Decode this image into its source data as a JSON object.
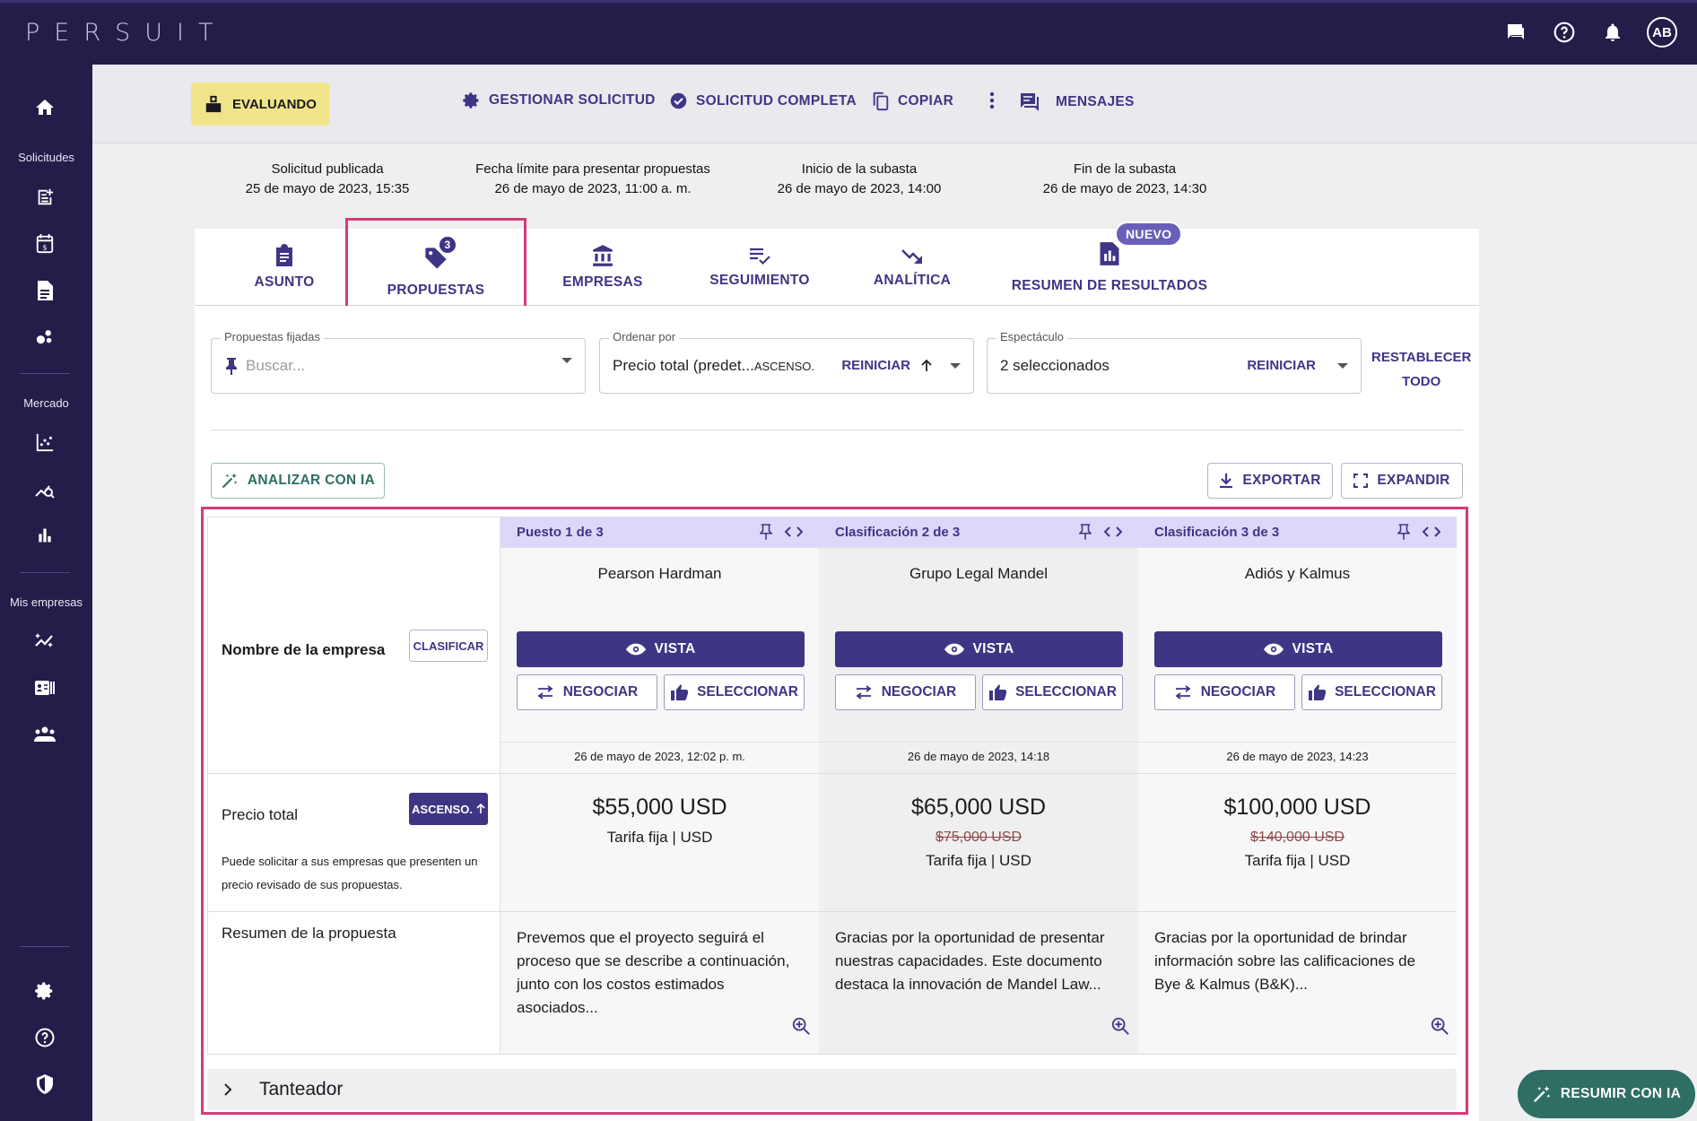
{
  "app": {
    "logo": "PERSUIT",
    "avatar_initials": "AB"
  },
  "sidebar": {
    "section_solicitudes": "Solicitudes",
    "section_mercado": "Mercado",
    "section_empresas": "Mis empresas"
  },
  "actionbar": {
    "status": "EVALUANDO",
    "manage": "GESTIONAR SOLICITUD",
    "complete": "SOLICITUD COMPLETA",
    "copy": "COPIAR",
    "messages": "MENSAJES"
  },
  "dates": [
    {
      "label": "Solicitud publicada",
      "value": "25 de mayo de 2023, 15:35"
    },
    {
      "label": "Fecha límite para presentar propuestas",
      "value": "26 de mayo de 2023, 11:00 a. m."
    },
    {
      "label": "Inicio de la subasta",
      "value": "26 de mayo de 2023, 14:00"
    },
    {
      "label": "Fin de la subasta",
      "value": "26 de mayo de 2023, 14:30"
    }
  ],
  "tabs": {
    "asunto": "ASUNTO",
    "propuestas": "PROPUESTAS",
    "propuestas_badge": "3",
    "empresas": "EMPRESAS",
    "seguimiento": "SEGUIMIENTO",
    "analitica": "ANALÍTICA",
    "resumen": "RESUMEN DE RESULTADOS",
    "resumen_badge": "NUEVO"
  },
  "filters": {
    "pinned_label": "Propuestas fijadas",
    "pinned_placeholder": "Buscar...",
    "sort_label": "Ordenar por",
    "sort_value": "Precio total (predet...",
    "sort_dir": "ASCENSO.",
    "sort_reset": "REINICIAR",
    "show_label": "Espectáculo",
    "show_value": "2 seleccionados",
    "show_reset": "REINICIAR",
    "reset_all_line1": "RESTABLECER",
    "reset_all_line2": "TODO"
  },
  "toolbar": {
    "analyze": "ANALIZAR CON IA",
    "export": "EXPORTAR",
    "expand": "EXPANDIR"
  },
  "table": {
    "row_company_label": "Nombre de la empresa",
    "rank_button": "CLASIFICAR",
    "row_price_label": "Precio total",
    "price_sort_button": "ASCENSO.",
    "price_note": "Puede solicitar a sus empresas que presenten un precio revisado de sus propuestas.",
    "row_summary_label": "Resumen de la propuesta",
    "view_label": "VISTA",
    "negotiate_label": "NEGOCIAR",
    "select_label": "SELECCIONAR",
    "columns": [
      {
        "rank": "Puesto 1 de 3",
        "company": "Pearson Hardman",
        "date": "26 de mayo de 2023, 12:02 p. m.",
        "price": "$55,000 USD",
        "old_price": "",
        "fee": "Tarifa fija | USD",
        "summary": "Prevemos que el proyecto seguirá el proceso que se describe a continuación, junto con los costos estimados asociados..."
      },
      {
        "rank": "Clasificación 2 de 3",
        "company": "Grupo Legal Mandel",
        "date": "26 de mayo de 2023, 14:18",
        "price": "$65,000 USD",
        "old_price": "$75,000 USD",
        "fee": "Tarifa fija | USD",
        "summary": "Gracias por la oportunidad de presentar nuestras capacidades. Este documento destaca la innovación de Mandel Law..."
      },
      {
        "rank": "Clasificación 3 de 3",
        "company": "Adiós y Kalmus",
        "date": "26 de mayo de 2023, 14:23",
        "price": "$100,000 USD",
        "old_price": "$140,000 USD",
        "fee": "Tarifa fija | USD",
        "summary": "Gracias por la oportunidad de brindar información sobre las calificaciones de Bye & Kalmus (B&K)..."
      }
    ],
    "scoreboard": "Tanteador"
  },
  "fab": {
    "label": "RESUMIR CON IA"
  },
  "colors": {
    "primary": "#3f3585",
    "nav_bg": "#231d4a",
    "highlight": "#d63a7a",
    "status_chip": "#f0e48a",
    "ai_green": "#2e6e63"
  }
}
